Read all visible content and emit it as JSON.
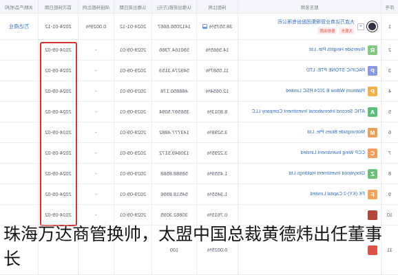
{
  "table": {
    "headers": [
      "序号",
      "股东名称",
      "持股比例",
      "认缴出资额(万元)",
      "认缴出资日期",
      "间接持股比例",
      "首次持股日期",
      "关联产品/机构"
    ],
    "rows": [
      {
        "index": "1",
        "logo": {
          "letter": "",
          "color": "#2d3340",
          "shape": "circle"
        },
        "expand": "+",
        "name": "大连万达商业管理集团股份有限公司",
        "tags": [
          "大股东",
          "股权出质"
        ],
        "ratio": "38.5575%",
        "ratio_icon": "chart-icon",
        "amount": "1412056.6667",
        "sub_date": "2024-01-12",
        "indirect": "0.0029%",
        "first_date": "2024-01-12",
        "related": "万达商业"
      },
      {
        "index": "2",
        "logo": {
          "letter": "R",
          "color": "#86c786"
        },
        "name": "Riverside Heights Pte. Ltd",
        "ratio": "14.5665%",
        "amount": "590164.7366",
        "sub_date": "2029-09-01",
        "indirect": "-",
        "first_date": "2024-09-02",
        "related": ""
      },
      {
        "index": "3",
        "logo": {
          "letter": "P",
          "color": "#8a98e3"
        },
        "name": "PACIFIC STONE PTE. LTD",
        "ratio": "11.5587%",
        "amount": "549274.3153",
        "sub_date": "2029-09-01",
        "indirect": "-",
        "first_date": "2024-09-02",
        "related": ""
      },
      {
        "index": "4",
        "logo": {
          "letter": "P",
          "color": "#f0b04a"
        },
        "name": "Platinum Willow B 2024 RSC Limited",
        "ratio": "12.0654%",
        "amount": "488850.178",
        "sub_date": "2029-09-01",
        "indirect": "-",
        "first_date": "2024-09-02",
        "related": ""
      },
      {
        "index": "5",
        "logo": {
          "letter": "A",
          "color": "#5cbf7c"
        },
        "name": "ATIC Second International Investment Company LLC",
        "ratio": "8.8013%",
        "amount": "356597.5094",
        "sub_date": "2029-09-01",
        "indirect": "-",
        "first_date": "2024-09-02",
        "related": ""
      },
      {
        "index": "6",
        "logo": {
          "letter": "M",
          "color": "#e8a25a"
        },
        "name": "Morningside Blues Pte. Ltd",
        "ratio": "3.5298%",
        "amount": "143777.4882",
        "sub_date": "2029-09-01",
        "indirect": "-",
        "first_date": "2024-09-02",
        "related": ""
      },
      {
        "index": "7",
        "logo": {
          "letter": "C",
          "color": "#f29e5c"
        },
        "name": "CCP Wing Investment Limited",
        "ratio": "3.2295%",
        "amount": "130849.5172",
        "sub_date": "2029-09-01",
        "indirect": "-",
        "first_date": "2024-09-02",
        "related": ""
      },
      {
        "index": "8",
        "logo": {
          "letter": "Z",
          "color": "#6cbf7a"
        },
        "name": "Glorywood Investment Holdings Ltd",
        "ratio": "1.4559%",
        "amount": "58988.8588",
        "sub_date": "2029-09-01",
        "indirect": "-",
        "first_date": "2024-09-02",
        "related": ""
      },
      {
        "index": "9",
        "logo": {
          "letter": "F",
          "color": "#f0a55b"
        },
        "name": "FK (KY)-2 Capital Limited",
        "ratio": "1.3455%",
        "amount": "54518.8996",
        "sub_date": "2029-09-01",
        "indirect": "-",
        "first_date": "2024-09-02",
        "related": ""
      },
      {
        "index": "10",
        "logo": {
          "letter": "",
          "color": "#b5483d"
        },
        "name": "",
        "ratio": "0.7615%",
        "amount": "30862.3095",
        "sub_date": "2029-09-01",
        "indirect": "-",
        "first_date": "2024-09-02",
        "related": ""
      },
      {
        "index": "11",
        "logo": {
          "letter": "",
          "color": "#d9534a"
        },
        "name": "",
        "ratio": "0.0025%",
        "amount": "100",
        "sub_date": "",
        "indirect": "",
        "first_date": "",
        "related": ""
      }
    ]
  },
  "highlight": {
    "color": "#d5322f",
    "column": "首次持股日期"
  },
  "caption": "珠海万达商管换帅，太盟中国总裁黄德炜出任董事长"
}
